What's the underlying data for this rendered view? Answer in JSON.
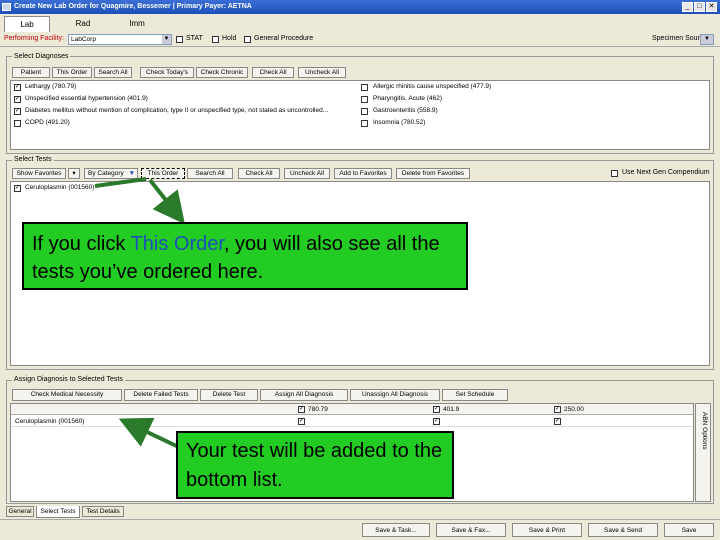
{
  "window": {
    "title": "Create New Lab Order for Quagmire, Bessemer | Primary Payer: AETNA",
    "min_label": "_",
    "max_label": "□",
    "close_label": "✕"
  },
  "tabs": [
    {
      "label": "Lab"
    },
    {
      "label": "Rad"
    },
    {
      "label": "Imm"
    }
  ],
  "toolbar": {
    "performing_facility_label": "Performing Facility:",
    "performing_facility_value": "LabCorp",
    "stat_label": "STAT",
    "hold_label": "Hold",
    "general_procedure_label": "General Procedure",
    "specimen_source_label": "Specimen Source"
  },
  "diagnoses": {
    "group_title": "Select Diagnoses",
    "buttons": [
      "Patient",
      "This Order",
      "Search All",
      "Check Today's",
      "Check Chronic",
      "Check All",
      "Uncheck All"
    ],
    "left_items": [
      {
        "label": "Lethargy (780.79)",
        "checked": true
      },
      {
        "label": "Unspecified essential hypertension (401.9)",
        "checked": true
      },
      {
        "label": "Diabetes mellitus without mention of complication, type II or unspecified type, not stated as uncontrolled...",
        "checked": true
      },
      {
        "label": "COPD (491.20)",
        "checked": false
      }
    ],
    "right_items": [
      {
        "label": "Allergic rhinitis cause unspecified (477.9)",
        "checked": false
      },
      {
        "label": "Pharyngitis, Acute (462)",
        "checked": false
      },
      {
        "label": "Gastroenteritis (558.9)",
        "checked": false
      },
      {
        "label": "Insomnia (780.52)",
        "checked": false
      }
    ]
  },
  "tests": {
    "group_title": "Select Tests",
    "show_favorites": "Show Favorites",
    "by_category": "By Category",
    "this_order": "This Order",
    "search_all": "Search All",
    "check_all": "Check All",
    "uncheck_all": "Uncheck All",
    "add_to_favorites": "Add to Favorites",
    "delete_from_favorites": "Delete from Favorites",
    "use_next_gen_label": "Use Next Gen Compendium",
    "items": [
      {
        "label": "Ceruloplasmin (001560)",
        "checked": true
      }
    ]
  },
  "callout_top": {
    "text_before": "If you click ",
    "highlight": "This Order",
    "text_after": ", you will also see all the tests you’ve ordered here."
  },
  "assign": {
    "group_title": "Assign Diagnosis to Selected Tests",
    "buttons": [
      "Check Medical Necessity",
      "Delete Failed Tests",
      "Delete Test",
      "Assign All Diagnosis",
      "Unassign All Diagnosis",
      "Set Schedule"
    ],
    "columns": [
      "780.79",
      "401.9",
      "250.00"
    ],
    "rows": [
      {
        "test": "Ceruloplasmin (001560)"
      }
    ],
    "side_tab": "ABN Options"
  },
  "callout_bottom": {
    "text": "Your test will be added to the bottom list."
  },
  "bottom_tabs": [
    "General",
    "Select Tests",
    "Test Details"
  ],
  "actions": [
    "Save & Task...",
    "Save & Fax...",
    "Save & Print",
    "Save & Send",
    "Save"
  ],
  "colors": {
    "callout": "#22cc22",
    "highlight": "#1f4fb8",
    "arrow": "#2b7a2b"
  }
}
